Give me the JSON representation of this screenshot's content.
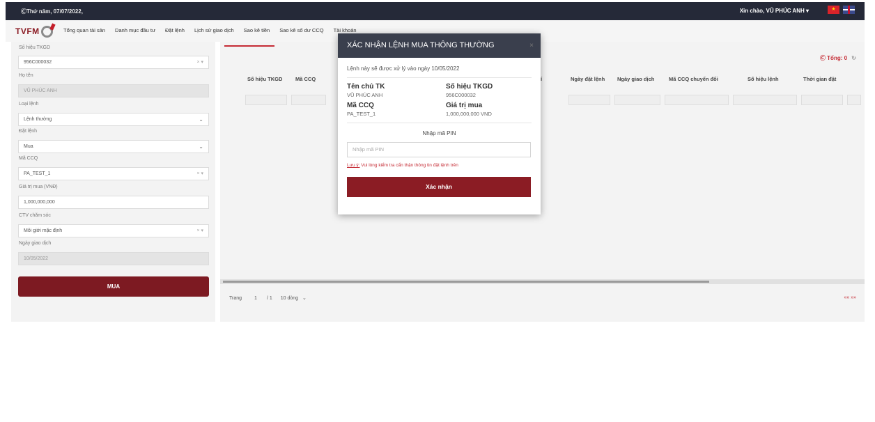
{
  "topbar": {
    "datetime": "ⒸThứ năm, 07/07/2022,",
    "greeting": "Xin chào, VŨ PHÚC ANH",
    "greeting_caret": "▾",
    "flag_vn_icon": "vn-flag-icon",
    "flag_uk_icon": "uk-flag-icon"
  },
  "brand": {
    "logo_text": "TVFM"
  },
  "nav": {
    "items": [
      "Tổng quan tài sản",
      "Danh mục đầu tư",
      "Đặt lệnh",
      "Lịch sử giao dịch",
      "Sao kê tiền",
      "Sao kê số dư CCQ",
      "Tài khoản"
    ]
  },
  "form": {
    "account_label": "Số hiệu TKGD",
    "account_value": "956C000032",
    "name_label": "Họ tên",
    "name_value": "VŨ PHÚC ANH",
    "order_type_label": "Loại lệnh",
    "order_type_value": "Lệnh thường",
    "side_label": "Đặt lệnh",
    "side_value": "Mua",
    "fund_label": "Mã CCQ",
    "fund_value": "PA_TEST_1",
    "amount_label": "Giá trị mua (VNĐ)",
    "amount_value": "1,000,000,000",
    "broker_label": "CTV chăm sóc",
    "broker_value": "Môi giới mặc định",
    "trade_date_label": "Ngày giao dịch",
    "trade_date_value": "10/05/2022",
    "clear_symbol": "× ▾",
    "chevron": "⌄",
    "buy_label": "MUA"
  },
  "table": {
    "total": "Ⓒ Tổng: 0",
    "refresh_icon": "↻",
    "headers": [
      "Số hiệu TKGD",
      "Mã CCQ",
      "í",
      "Ngày đặt lệnh",
      "Ngày giao dịch",
      "Mã CCQ chuyển đổi",
      "Số hiệu lệnh",
      "Thời gian đặt"
    ],
    "pager": {
      "label": "Trang",
      "page": "1",
      "total": "/ 1",
      "rows": "10 dòng",
      "rows_caret": "⌄",
      "arrows": "««  »»"
    }
  },
  "modal": {
    "title": "XÁC NHẬN LỆNH MUA THÔNG THƯỜNG",
    "close": "×",
    "note": "Lệnh này sẽ được xử lý vào ngày 10/05/2022",
    "owner_label": "Tên chủ TK",
    "owner_value": "VŨ PHÚC ANH",
    "account_label": "Số hiệu TKGD",
    "account_value": "956C000032",
    "fund_label": "Mã CCQ",
    "fund_value": "PA_TEST_1",
    "amount_label": "Giá trị mua",
    "amount_value": "1,000,000,000 VND",
    "pin_title": "Nhập mã PIN",
    "pin_placeholder": "Nhập mã PIN",
    "warn_label": "Lưu ý:",
    "warn_text": " Vui lòng kiểm tra cẩn thận thông tin đặt lệnh trên",
    "confirm_label": "Xác nhận"
  }
}
